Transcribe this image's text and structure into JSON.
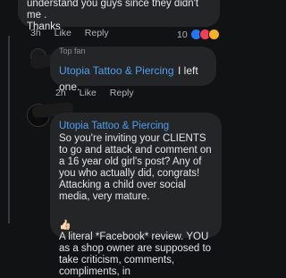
{
  "comment1": {
    "text": "understand you guys since they didn't me .\nThanks",
    "time": "3h",
    "like": "Like",
    "reply": "Reply",
    "reaction_count": "10"
  },
  "comment2": {
    "badge": "Top fan",
    "author": "Utopia Tattoo & Piercing",
    "text": "I left one.",
    "time": "2h",
    "like": "Like",
    "reply": "Reply"
  },
  "comment3": {
    "author": "Utopia Tattoo & Piercing",
    "text": "So you're inviting your CLIENTS to go and attack and comment on a 16 year old girl's post? Any of you who actually did, congrats! Attacking a child over social media, very mature.",
    "text2": "A literal *Facebook* review. YOU as a shop owner are supposed to take criticism, comments, compliments, in"
  },
  "colors": {
    "background": "#111214",
    "bubble": "#242526",
    "link": "#4f9ff0",
    "meta": "#b0b3b8"
  },
  "icons": [
    "thumbs-up-icon",
    "like-reaction-icon",
    "love-reaction-icon",
    "haha-reaction-icon"
  ]
}
